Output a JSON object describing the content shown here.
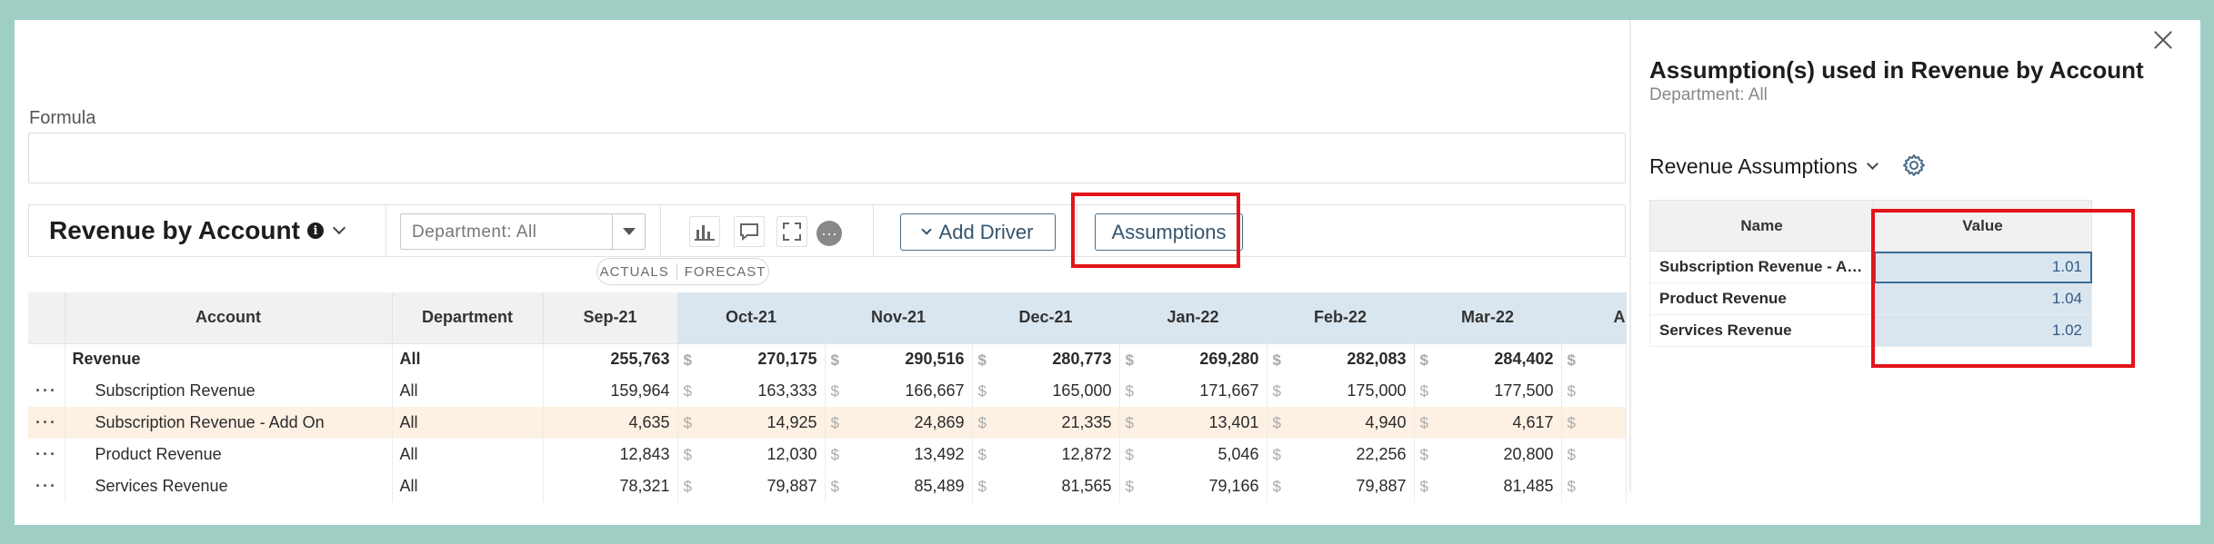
{
  "formula": {
    "label": "Formula",
    "value": ""
  },
  "toolbar": {
    "title": "Revenue by Account",
    "department_select": "Department: All",
    "add_driver_label": "Add Driver",
    "assumptions_label": "Assumptions",
    "more_label": "···"
  },
  "toggle": {
    "actuals": "ACTUALS",
    "forecast": "FORECAST"
  },
  "grid": {
    "headers": [
      "Account",
      "Department",
      "Sep-21",
      "Oct-21",
      "Nov-21",
      "Dec-21",
      "Jan-22",
      "Feb-22",
      "Mar-22",
      "A"
    ],
    "currency_symbol": "$",
    "row_menu": "···",
    "rows": [
      {
        "account": "Revenue",
        "dept": "All",
        "values": [
          "255,763",
          "270,175",
          "290,516",
          "280,773",
          "269,280",
          "282,083",
          "284,402"
        ]
      },
      {
        "account": "Subscription Revenue",
        "dept": "All",
        "values": [
          "159,964",
          "163,333",
          "166,667",
          "165,000",
          "171,667",
          "175,000",
          "177,500"
        ]
      },
      {
        "account": "Subscription Revenue - Add On",
        "dept": "All",
        "values": [
          "4,635",
          "14,925",
          "24,869",
          "21,335",
          "13,401",
          "4,940",
          "4,617"
        ]
      },
      {
        "account": "Product Revenue",
        "dept": "All",
        "values": [
          "12,843",
          "12,030",
          "13,492",
          "12,872",
          "5,046",
          "22,256",
          "20,800"
        ]
      },
      {
        "account": "Services Revenue",
        "dept": "All",
        "values": [
          "78,321",
          "79,887",
          "85,489",
          "81,565",
          "79,166",
          "79,887",
          "81,485"
        ]
      }
    ]
  },
  "panel": {
    "title": "Assumption(s) used in Revenue by Account",
    "subtitle": "Department: All",
    "section_title": "Revenue Assumptions",
    "headers": [
      "Name",
      "Value"
    ],
    "rows": [
      {
        "name": "Subscription Revenue - Ad...",
        "value": "1.01"
      },
      {
        "name": "Product Revenue",
        "value": "1.04"
      },
      {
        "name": "Services Revenue",
        "value": "1.02"
      }
    ]
  },
  "colors": {
    "highlight_red": "#e3141a",
    "forecast_header": "#dae6ef",
    "accent": "#34546e",
    "row_highlight": "#fcf1e3"
  }
}
